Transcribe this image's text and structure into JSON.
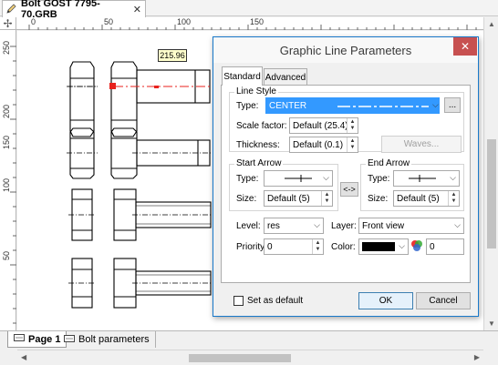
{
  "document": {
    "tab_title": "Bolt GOST 7795-70.GRB",
    "close_glyph": "✕"
  },
  "ruler": {
    "top": [
      "0",
      "50",
      "100",
      "150"
    ],
    "left": [
      "250",
      "200",
      "150",
      "100",
      "50"
    ]
  },
  "drawing": {
    "dimension_value": "215.96"
  },
  "dialog": {
    "title": "Graphic Line Parameters",
    "close_glyph": "✕",
    "tabs": [
      "Standard",
      "Advanced"
    ],
    "line_style": {
      "group_label": "Line Style",
      "type_label": "Type:",
      "type_value": "CENTER",
      "browse_label": "...",
      "scale_label": "Scale factor:",
      "scale_value": "Default (25.4)",
      "thickness_label": "Thickness:",
      "thickness_value": "Default (0.1)",
      "waves_label": "Waves..."
    },
    "start_arrow": {
      "group_label": "Start Arrow",
      "type_label": "Type:",
      "size_label": "Size:",
      "size_value": "Default (5)"
    },
    "swap_label": "<->",
    "end_arrow": {
      "group_label": "End Arrow",
      "type_label": "Type:",
      "size_label": "Size:",
      "size_value": "Default (5)"
    },
    "level_label": "Level:",
    "level_value": "res",
    "layer_label": "Layer:",
    "layer_value": "Front view",
    "priority_label": "Priority:",
    "priority_value": "0",
    "color_label": "Color:",
    "color_hex": "#000000",
    "color_number": "0",
    "set_default_label": "Set as default",
    "ok_label": "OK",
    "cancel_label": "Cancel"
  },
  "page_tabs": [
    "Page 1",
    "Bolt parameters"
  ],
  "colors": {
    "selection": "#3399ff",
    "highlight_red": "#e8211c",
    "dimension_box": "#ffffcc"
  }
}
